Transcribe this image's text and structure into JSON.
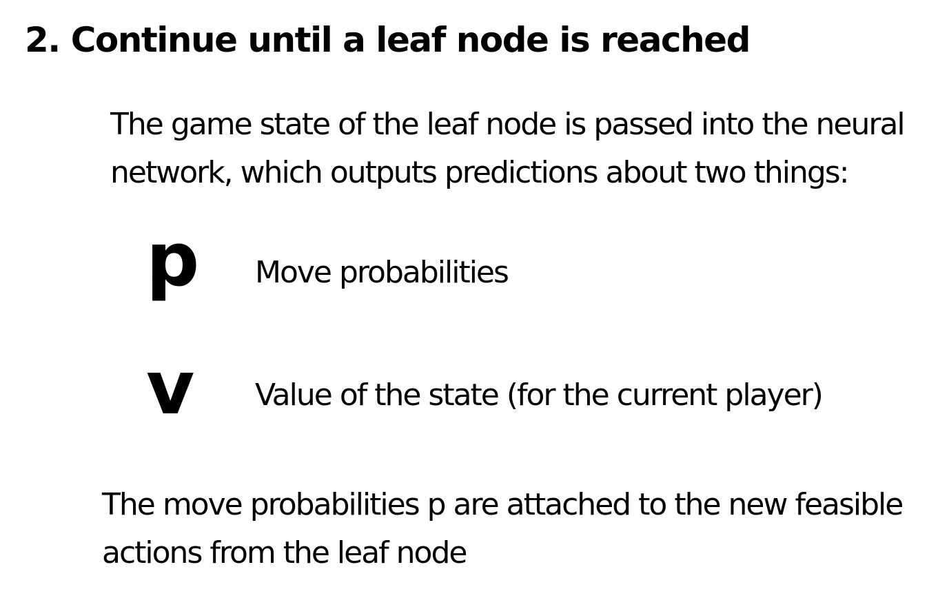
{
  "heading": "2. Continue until a leaf node is reached",
  "intro": "The game state of the leaf node is passed into the neural network, which outputs predictions about two things:",
  "outputs": [
    {
      "symbol": "p",
      "description": "Move probabilities"
    },
    {
      "symbol": "v",
      "description": "Value of the state (for the current player)"
    }
  ],
  "outro": "The move probabilities p are attached to the new feasible actions from the leaf node"
}
